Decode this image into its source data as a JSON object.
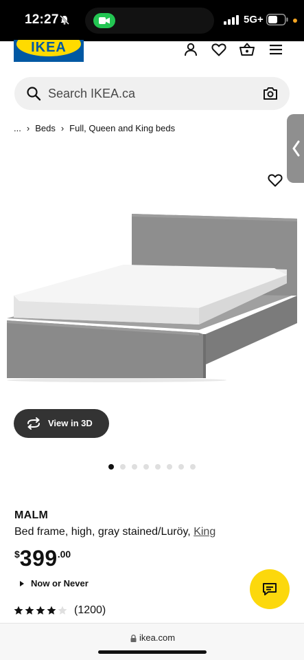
{
  "status_bar": {
    "time": "12:27",
    "network": "5G+",
    "accent_colors": {
      "facetime": "#23c552",
      "orange_dot": "#f5a623"
    }
  },
  "header": {
    "logo_text": "IKEA",
    "icons": [
      "user-icon",
      "heart-icon",
      "basket-icon",
      "menu-icon"
    ],
    "brand_colors": {
      "blue": "#0058a3",
      "yellow": "#ffdb00"
    }
  },
  "search": {
    "placeholder": "Search IKEA.ca"
  },
  "breadcrumb": {
    "items": [
      "...",
      "Beds",
      "Full, Queen and King beds"
    ]
  },
  "product": {
    "view_3d_label": "View in 3D",
    "image_count": 8,
    "active_image": 1,
    "name": "MALM",
    "description": "Bed frame, high, gray stained/Luröy,",
    "size_link": "King",
    "price": {
      "currency": "$",
      "integer": "399",
      "decimal": ".00"
    },
    "promo": "Now or Never",
    "rating": {
      "stars": 4,
      "max": 5,
      "count": "(1200)"
    }
  },
  "browser": {
    "url": "ikea.com"
  }
}
